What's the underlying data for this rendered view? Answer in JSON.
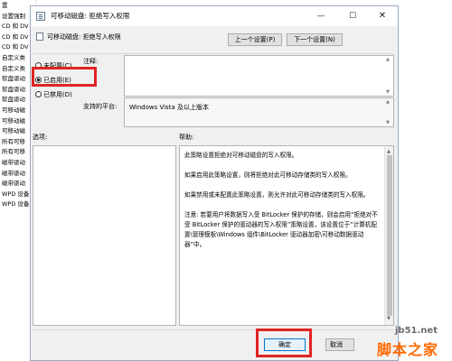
{
  "background_list": {
    "items": [
      "置",
      "设置强制",
      "CD 和 DV",
      "CD 和 DV",
      "CD 和 DV",
      "自定义类",
      "自定义类",
      "软盘驱动",
      "软盘驱动",
      "软盘驱动",
      "可移动磁",
      "可移动磁",
      "可移动磁",
      "所有可移",
      "所有可移",
      "磁带驱动",
      "磁带驱动",
      "磁带驱动",
      "WPD 设备",
      "WPD 设备"
    ]
  },
  "dialog": {
    "title": "可移动磁盘: 拒绝写入权限",
    "window_controls": {
      "minimize": "—",
      "maximize": "☐",
      "close": "✕"
    },
    "setting_name": "可移动磁盘: 拒绝写入权限",
    "prev_button": "上一个设置(P)",
    "next_button": "下一个设置(N)",
    "radios": [
      {
        "label": "未配置(C)",
        "checked": false
      },
      {
        "label": "已启用(E)",
        "checked": true
      },
      {
        "label": "已禁用(D)",
        "checked": false
      }
    ],
    "comment_label": "注释:",
    "comment_value": "",
    "platform_label": "支持的平台:",
    "platform_value": "Windows Vista 及以上版本",
    "options_label": "选项:",
    "help_label": "帮助:",
    "help_paragraphs": [
      "此策略设置拒绝对可移动磁盘的写入权限。",
      "如果启用此策略设置，则将拒绝对此可移动存储类的写入权限。",
      "如果禁用或未配置此策略设置，则允许对此可移动存储类的写入权限。",
      "注意: 若要用户将数据写入受 BitLocker 保护的存储，则会启用“拒绝对不受 BitLocker 保护的驱动器的写入权限”策略设置，该设置位于“计算机配置\\管理模板\\Windows 组件\\BitLocker 驱动器加密\\可移动数据驱动器”中。"
    ],
    "ok_button": "确定",
    "cancel_button": "取消"
  },
  "watermark": {
    "url": "jb51.net",
    "name": "脚本之家"
  },
  "colors": {
    "highlight": "#e02424",
    "dialog_bg": "#f0f0f0",
    "watermark_orange": "#ff6a00"
  }
}
